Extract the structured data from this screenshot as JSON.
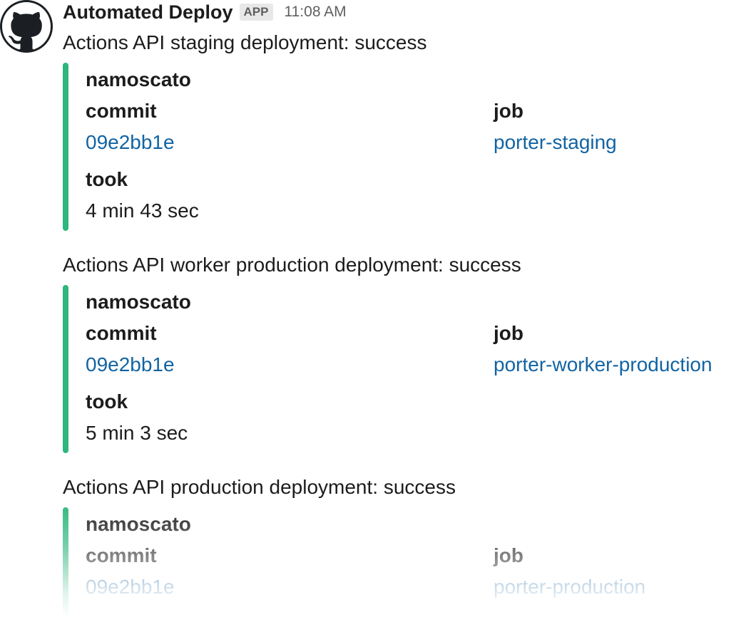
{
  "message": {
    "sender": "Automated Deploy",
    "badge": "APP",
    "timestamp": "11:08 AM",
    "avatar_icon": "github-icon"
  },
  "accent_color": "#2eb67d",
  "link_color": "#1264a3",
  "deployments": [
    {
      "title": "Actions API staging deployment: success",
      "author": "namoscato",
      "commit_label": "commit",
      "commit_value": "09e2bb1e",
      "job_label": "job",
      "job_value": "porter-staging",
      "took_label": "took",
      "took_value": "4 min 43 sec"
    },
    {
      "title": "Actions API worker production deployment: success",
      "author": "namoscato",
      "commit_label": "commit",
      "commit_value": "09e2bb1e",
      "job_label": "job",
      "job_value": "porter-worker-production",
      "took_label": "took",
      "took_value": "5 min 3 sec"
    },
    {
      "title": "Actions API production deployment: success",
      "author": "namoscato",
      "commit_label": "commit",
      "commit_value": "09e2bb1e",
      "job_label": "job",
      "job_value": "porter-production"
    }
  ]
}
